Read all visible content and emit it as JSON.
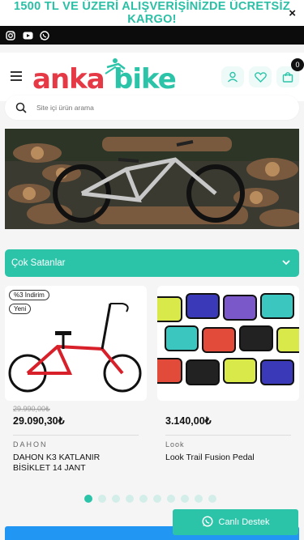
{
  "promo": {
    "text": "1500 TL VE ÜZERİ ALIŞVERİŞİNİZDE ÜCRETSİZ KARGO!",
    "close": "×"
  },
  "social": {
    "icons": [
      "instagram-icon",
      "youtube-icon",
      "whatsapp-icon"
    ]
  },
  "header": {
    "cart_count": "0",
    "logo_text": "ankabike"
  },
  "search": {
    "placeholder": "Site içi ürün arama"
  },
  "section": {
    "title": "Çok Satanlar"
  },
  "products": [
    {
      "badges": [
        "%3 İndirim",
        "Yeni"
      ],
      "old_price": "29.990,00₺",
      "price": "29.090,30₺",
      "brand": "DAHON",
      "name": "DAHON K3 KATLANIR BİSİKLET 14 JANT"
    },
    {
      "badges": [],
      "old_price": "",
      "price": "3.140,00₺",
      "brand": "Look",
      "name": "Look Trail Fusion Pedal"
    }
  ],
  "carousel": {
    "dot_count": 10,
    "active_index": 0
  },
  "support": {
    "label": "Canlı Destek"
  },
  "colors": {
    "accent": "#2bc4a9",
    "dark": "#0c0c0c",
    "logo_red": "#e63946"
  }
}
